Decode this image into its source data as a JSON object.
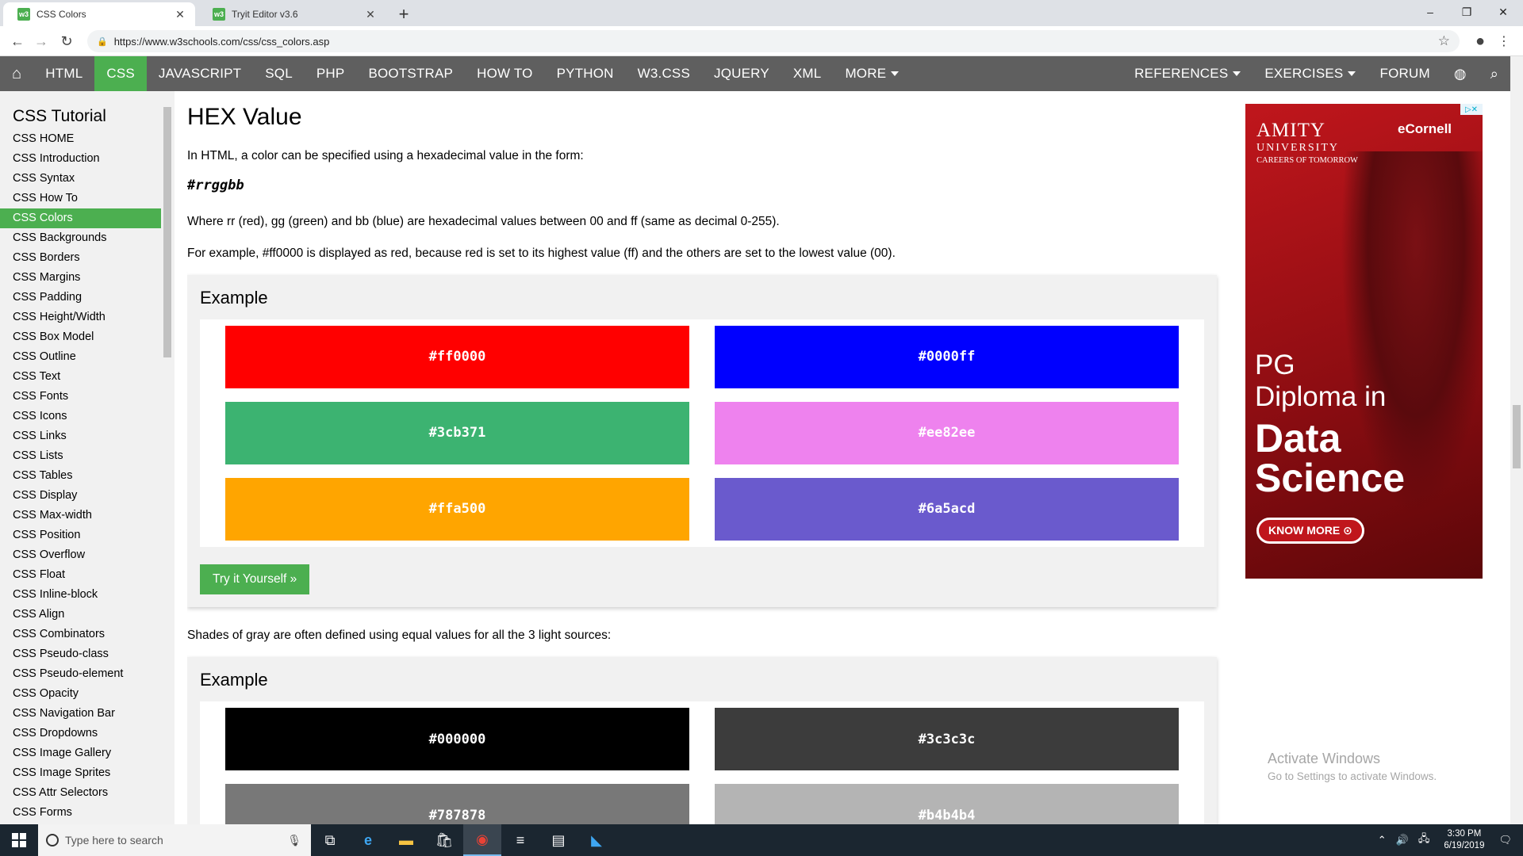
{
  "browser": {
    "tabs": [
      {
        "title": "CSS Colors",
        "favicon": "w3"
      },
      {
        "title": "Tryit Editor v3.6",
        "favicon": "w3"
      }
    ],
    "url": "https://www.w3schools.com/css/css_colors.asp",
    "window_controls": {
      "minimize": "–",
      "maximize": "❐",
      "close": "✕"
    }
  },
  "topnav": {
    "home_icon": "home-icon",
    "items": [
      "HTML",
      "CSS",
      "JAVASCRIPT",
      "SQL",
      "PHP",
      "BOOTSTRAP",
      "HOW TO",
      "PYTHON",
      "W3.CSS",
      "JQUERY",
      "XML",
      "MORE"
    ],
    "active": "CSS",
    "right_items": [
      "REFERENCES",
      "EXERCISES",
      "FORUM"
    ],
    "accent_color": "#4caf50",
    "bar_color": "#5f5f5f"
  },
  "sidebar": {
    "title": "CSS Tutorial",
    "items": [
      "CSS HOME",
      "CSS Introduction",
      "CSS Syntax",
      "CSS How To",
      "CSS Colors",
      "CSS Backgrounds",
      "CSS Borders",
      "CSS Margins",
      "CSS Padding",
      "CSS Height/Width",
      "CSS Box Model",
      "CSS Outline",
      "CSS Text",
      "CSS Fonts",
      "CSS Icons",
      "CSS Links",
      "CSS Lists",
      "CSS Tables",
      "CSS Display",
      "CSS Max-width",
      "CSS Position",
      "CSS Overflow",
      "CSS Float",
      "CSS Inline-block",
      "CSS Align",
      "CSS Combinators",
      "CSS Pseudo-class",
      "CSS Pseudo-element",
      "CSS Opacity",
      "CSS Navigation Bar",
      "CSS Dropdowns",
      "CSS Image Gallery",
      "CSS Image Sprites",
      "CSS Attr Selectors",
      "CSS Forms"
    ],
    "active_index": 4
  },
  "main": {
    "heading": "HEX Value",
    "intro": "In HTML, a color can be specified using a hexadecimal value in the form:",
    "code": "#rrggbb",
    "para1": "Where rr (red), gg (green) and bb (blue) are hexadecimal values between 00 and ff (same as decimal 0-255).",
    "para2": "For example, #ff0000 is displayed as red, because red is set to its highest value (ff) and the others are set to the lowest value (00).",
    "example1": {
      "title": "Example",
      "swatches": [
        {
          "label": "#ff0000",
          "color": "#ff0000"
        },
        {
          "label": "#0000ff",
          "color": "#0000ff"
        },
        {
          "label": "#3cb371",
          "color": "#3cb371"
        },
        {
          "label": "#ee82ee",
          "color": "#ee82ee"
        },
        {
          "label": "#ffa500",
          "color": "#ffa500"
        },
        {
          "label": "#6a5acd",
          "color": "#6a5acd"
        }
      ],
      "button": "Try it Yourself »"
    },
    "para3": "Shades of gray are often defined using equal values for all the 3 light sources:",
    "example2": {
      "title": "Example",
      "swatches": [
        {
          "label": "#000000",
          "color": "#000000"
        },
        {
          "label": "#3c3c3c",
          "color": "#3c3c3c"
        },
        {
          "label": "#787878",
          "color": "#787878"
        },
        {
          "label": "#b4b4b4",
          "color": "#b4b4b4"
        }
      ]
    }
  },
  "ad": {
    "brand1": "AMITY",
    "brand1_sub": "UNIVERSITY",
    "brand1_tag": "CAREERS OF TOMORROW",
    "brand2": "eCornell",
    "headline1": "PG",
    "headline2": "Diploma in",
    "headline3": "Data",
    "headline4": "Science",
    "cta": "KNOW MORE"
  },
  "watermark": {
    "title": "Activate Windows",
    "subtitle": "Go to Settings to activate Windows."
  },
  "taskbar": {
    "search_placeholder": "Type here to search",
    "time": "3:30 PM",
    "date": "6/19/2019"
  }
}
